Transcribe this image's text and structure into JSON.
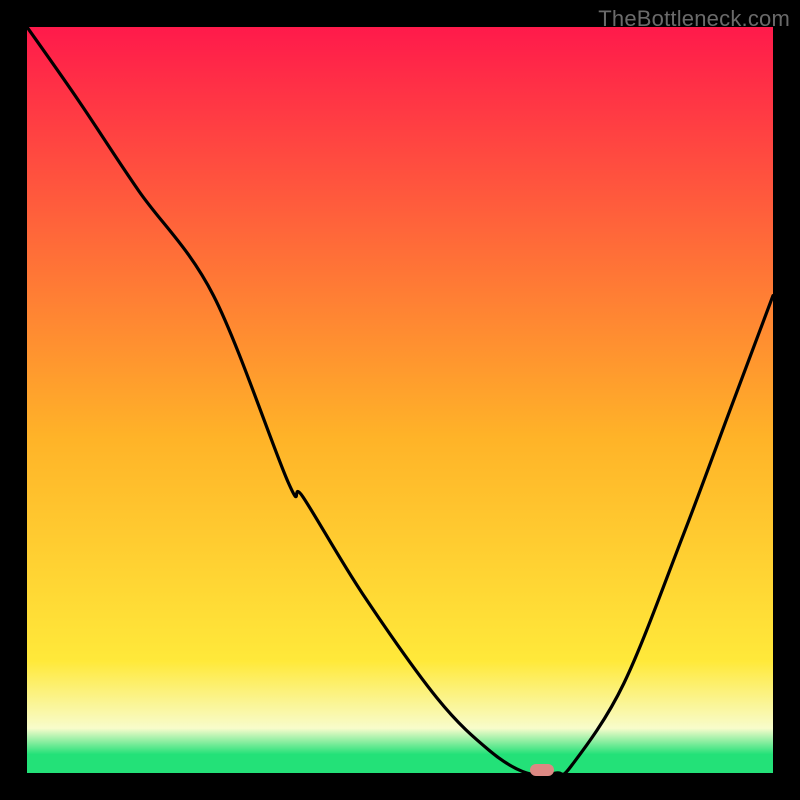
{
  "watermark": "TheBottleneck.com",
  "colors": {
    "top": "#ff1a4b",
    "mid_upper": "#ffb328",
    "mid_lower": "#ffe93a",
    "pale": "#f8fccb",
    "green": "#23e178",
    "bg": "#000000",
    "curve": "#000000",
    "marker": "#dd8883"
  },
  "chart_data": {
    "type": "line",
    "title": "",
    "xlabel": "",
    "ylabel": "",
    "xlim": [
      0,
      100
    ],
    "ylim": [
      0,
      100
    ],
    "x": [
      0,
      7,
      15,
      25,
      35,
      37,
      45,
      55,
      62,
      67,
      71,
      73,
      80,
      88,
      94,
      100
    ],
    "values": [
      100,
      90,
      78,
      64,
      39,
      37,
      24,
      10,
      3,
      0,
      0,
      1,
      12,
      32,
      48,
      64
    ],
    "marker": {
      "x": 69,
      "y": 0
    },
    "gradient_bands_pct_from_top": {
      "top_to_mid_upper": [
        0,
        55
      ],
      "mid_upper_to_mid_lower": [
        55,
        85
      ],
      "mid_lower_to_pale": [
        85,
        94
      ],
      "pale_to_green": [
        94,
        97.5
      ],
      "green": [
        97.5,
        100
      ]
    }
  }
}
